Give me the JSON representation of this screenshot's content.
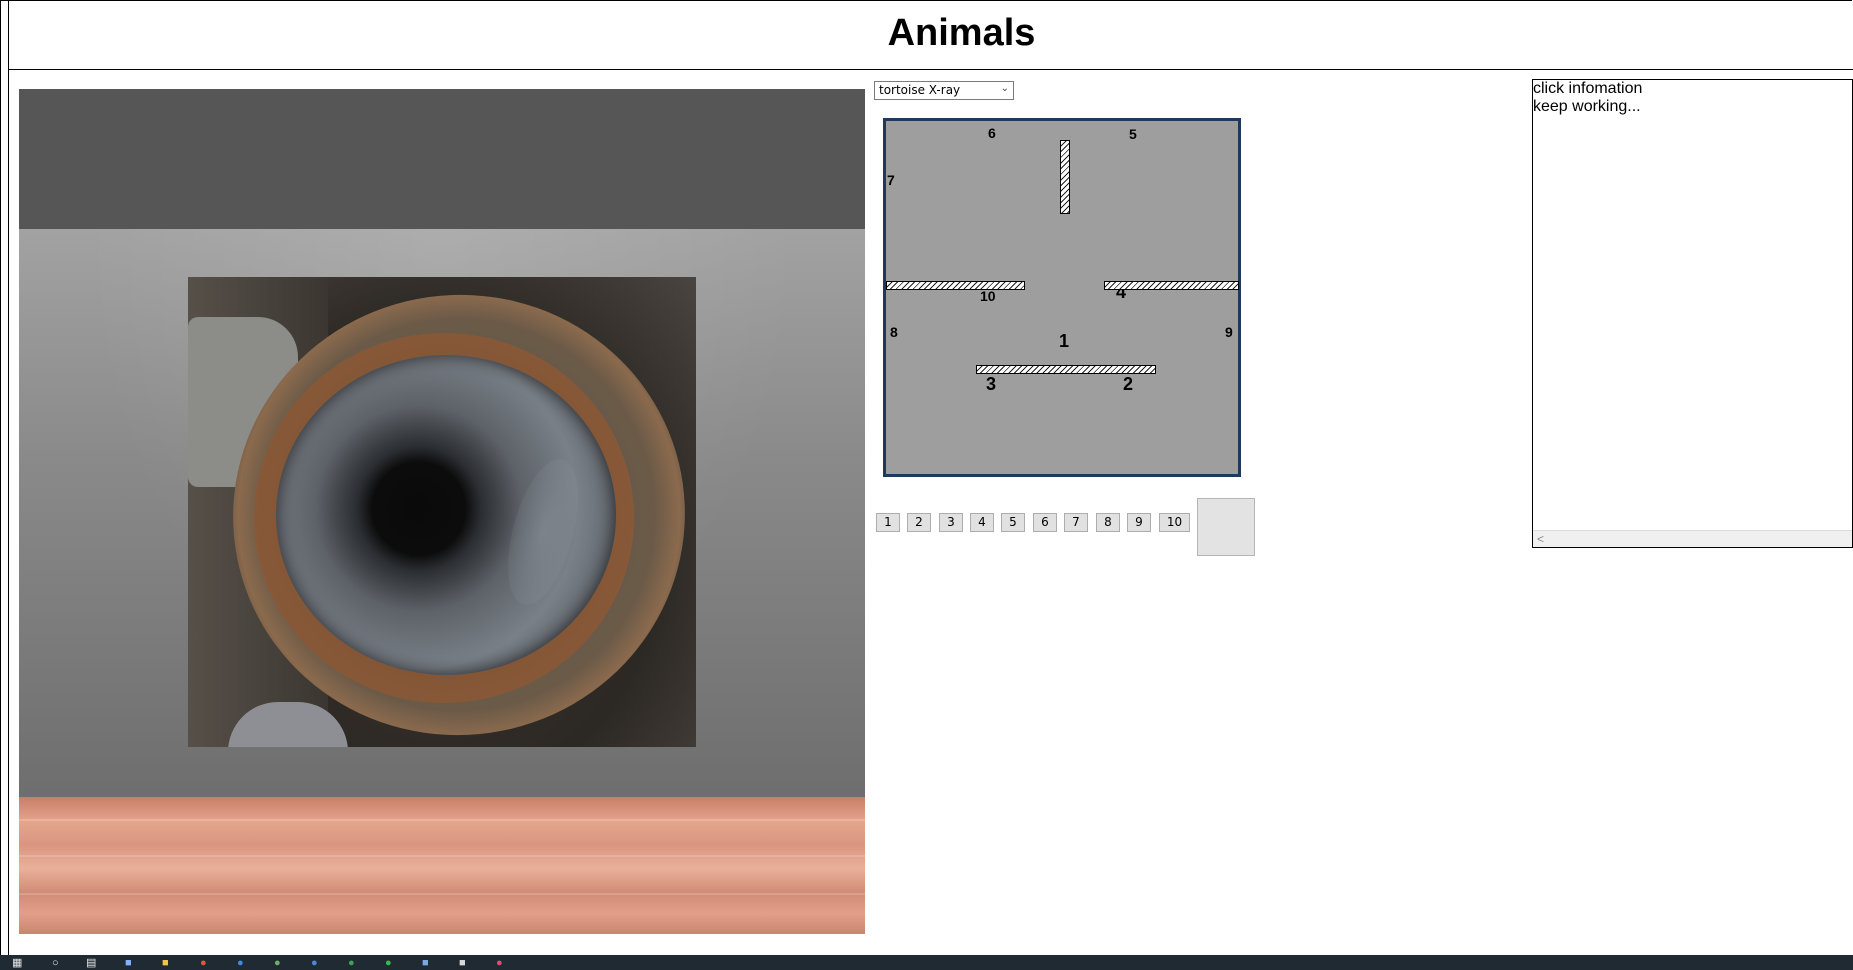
{
  "page": {
    "title": "Animals"
  },
  "scene": {
    "description_visible": false
  },
  "selector": {
    "selected": "tortoise X-ray"
  },
  "map": {
    "room_labels": [
      "6",
      "5",
      "7",
      "10",
      "4",
      "8",
      "1",
      "9",
      "3",
      "2"
    ]
  },
  "room_buttons": [
    "1",
    "2",
    "3",
    "4",
    "5",
    "6",
    "7",
    "8",
    "9",
    "10"
  ],
  "info_panel": {
    "lines": [
      "click infomation",
      "keep working..."
    ]
  },
  "taskbar": {
    "icons": [
      "windows-start-icon",
      "search-icon",
      "task-view-icon",
      "file-icon",
      "folder-icon",
      "chrome-icon",
      "edge-icon",
      "app-icon",
      "app-icon",
      "app-icon",
      "line-icon",
      "mail-icon",
      "notepad-icon",
      "app-icon"
    ]
  }
}
